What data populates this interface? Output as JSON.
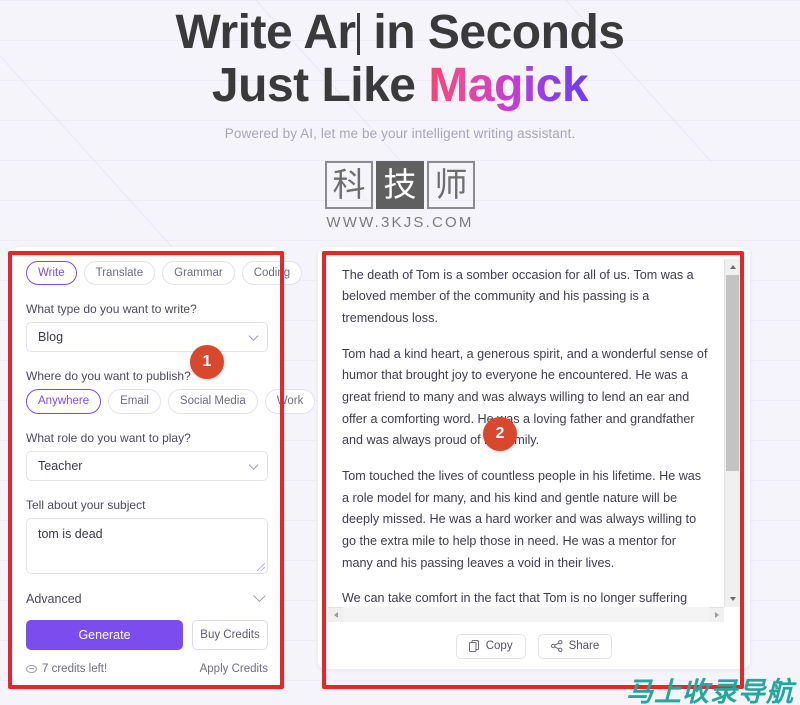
{
  "hero": {
    "title_part1": "Write Ar",
    "title_part2": " in Seconds",
    "title_line2_prefix": "Just Like ",
    "title_line2_accent": "Magick",
    "subtitle": "Powered by AI, let me be your intelligent writing assistant.",
    "accent_gradient_start": "#f8446e",
    "accent_gradient_end": "#6d3bf0",
    "title_color": "#3a3a3c",
    "subtitle_color": "#a8a5bb"
  },
  "logo": {
    "char1": "科",
    "char2": "技",
    "char3": "师",
    "url": "WWW.3KJS.COM"
  },
  "left_panel": {
    "mode_tabs": [
      {
        "label": "Write",
        "active": true
      },
      {
        "label": "Translate",
        "active": false
      },
      {
        "label": "Grammar",
        "active": false
      },
      {
        "label": "Coding",
        "active": false
      }
    ],
    "type_label": "What type do you want to write?",
    "type_value": "Blog",
    "publish_label": "Where do you want to publish?",
    "publish_chips": [
      {
        "label": "Anywhere",
        "active": true
      },
      {
        "label": "Email",
        "active": false
      },
      {
        "label": "Social Media",
        "active": false
      },
      {
        "label": "Work",
        "active": false
      }
    ],
    "role_label": "What role do you want to play?",
    "role_value": "Teacher",
    "subject_label": "Tell about your subject",
    "subject_value": "tom is dead",
    "advanced_label": "Advanced",
    "generate_label": "Generate",
    "buy_credits_label": "Buy Credits",
    "credits_text": "7 credits left!",
    "apply_credits_label": "Apply Credits",
    "generate_color": "#7c4dee",
    "active_chip_color": "#7c4dee"
  },
  "right_panel": {
    "paragraphs": [
      "The death of Tom is a somber occasion for all of us. Tom was a beloved member of the community and his passing is a tremendous loss.",
      "Tom had a kind heart, a generous spirit, and a wonderful sense of humor that brought joy to everyone he encountered. He was a great friend to many and was always willing to lend an ear and offer a comforting word. He was a loving father and grandfather and was always proud of his family.",
      "Tom touched the lives of countless people in his lifetime. He was a role model for many, and his kind and gentle nature will be deeply missed. He was a hard worker and was always willing to go the extra mile to help those in need. He was a mentor for many and his passing leaves a void in their lives.",
      "We can take comfort in the fact that Tom is no longer suffering and is now in a better place. We should take solace in the fact that he is no longer in pain and can now rest peacefully."
    ],
    "copy_label": "Copy",
    "share_label": "Share"
  },
  "annotations": {
    "badge_1": "1",
    "badge_2": "2",
    "box_color": "#e8262a",
    "badge_color": "#d9472c"
  },
  "watermark": {
    "text": "马上收录导航",
    "color": "#22a79b"
  }
}
